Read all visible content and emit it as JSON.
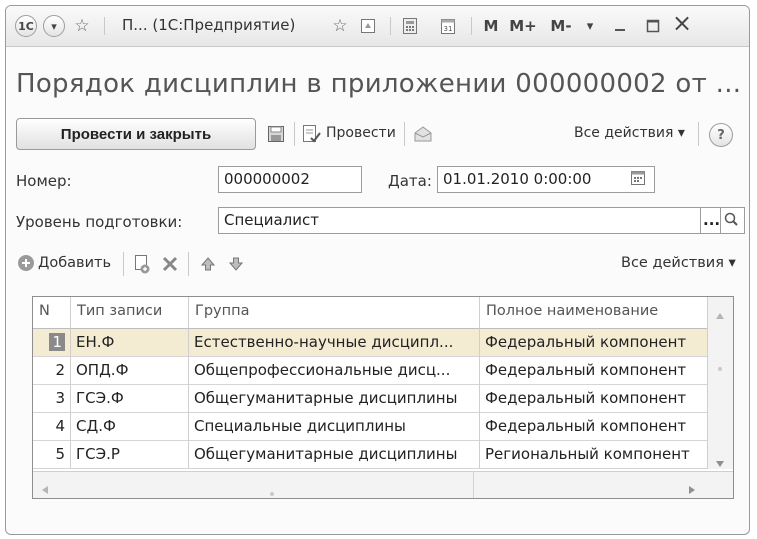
{
  "titlebar": {
    "logo": "1С",
    "title": "П...  (1С:Предприятие)",
    "btn_m": "M",
    "btn_mplus": "M+",
    "btn_mminus": "M-",
    "close": "×"
  },
  "document": {
    "title": "Порядок дисциплин в приложении 000000002 от ..."
  },
  "toolbar": {
    "post_close": "Провести и закрыть",
    "post": "Провести",
    "all_actions": "Все действия ▾",
    "help": "?"
  },
  "form": {
    "number_label": "Номер:",
    "number_value": "000000002",
    "date_label": "Дата:",
    "date_value": "01.01.2010  0:00:00",
    "level_label": "Уровень подготовки:",
    "level_value": "Специалист",
    "level_choose": "..."
  },
  "table_toolbar": {
    "add": "Добавить",
    "all_actions": "Все действия ▾"
  },
  "table": {
    "headers": [
      "N",
      "Тип записи",
      "Группа",
      "Полное наименование"
    ],
    "rows": [
      {
        "n": "1",
        "type": "ЕН.Ф",
        "group": "Естественно-научные дисципл...",
        "full": "Федеральный компонент"
      },
      {
        "n": "2",
        "type": "ОПД.Ф",
        "group": "Общепрофессиональные дисц...",
        "full": "Федеральный компонент"
      },
      {
        "n": "3",
        "type": "ГСЭ.Ф",
        "group": "Общегуманитарные дисциплины",
        "full": "Федеральный компонент"
      },
      {
        "n": "4",
        "type": "СД.Ф",
        "group": "Специальные дисциплины",
        "full": "Федеральный компонент"
      },
      {
        "n": "5",
        "type": "ГСЭ.Р",
        "group": "Общегуманитарные дисциплины",
        "full": "Региональный компонент"
      }
    ]
  },
  "colors": {
    "selected_row": "#f4ecd2",
    "accent_green": "#5aa02c"
  }
}
